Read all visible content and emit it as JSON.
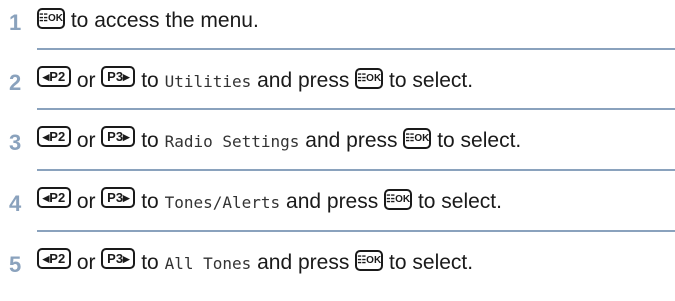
{
  "steps": [
    {
      "number": "1",
      "parts": {
        "key": "☷OK",
        "text": "to access the menu."
      }
    },
    {
      "number": "2",
      "parts": {
        "key_left": "◂P2",
        "or": "or",
        "key_right": "P3▸",
        "to": "to",
        "target": "Utilities",
        "and_press": "and press",
        "key_ok": "☷OK",
        "to_select": "to select."
      }
    },
    {
      "number": "3",
      "parts": {
        "key_left": "◂P2",
        "or": "or",
        "key_right": "P3▸",
        "to": "to",
        "target": "Radio Settings",
        "and_press": "and press",
        "key_ok": "☷OK",
        "to_select": "to select."
      }
    },
    {
      "number": "4",
      "parts": {
        "key_left": "◂P2",
        "or": "or",
        "key_right": "P3▸",
        "to": "to",
        "target": "Tones/Alerts",
        "and_press": "and press",
        "key_ok": "☷OK",
        "to_select": "to select."
      }
    },
    {
      "number": "5",
      "parts": {
        "key_left": "◂P2",
        "or": "or",
        "key_right": "P3▸",
        "to": "to",
        "target": "All Tones",
        "and_press": "and press",
        "key_ok": "☷OK",
        "to_select": "to select."
      }
    }
  ],
  "colors": {
    "step_number": "#8aa2bd",
    "divider": "#8aa2bd",
    "text": "#1a1a1a"
  }
}
